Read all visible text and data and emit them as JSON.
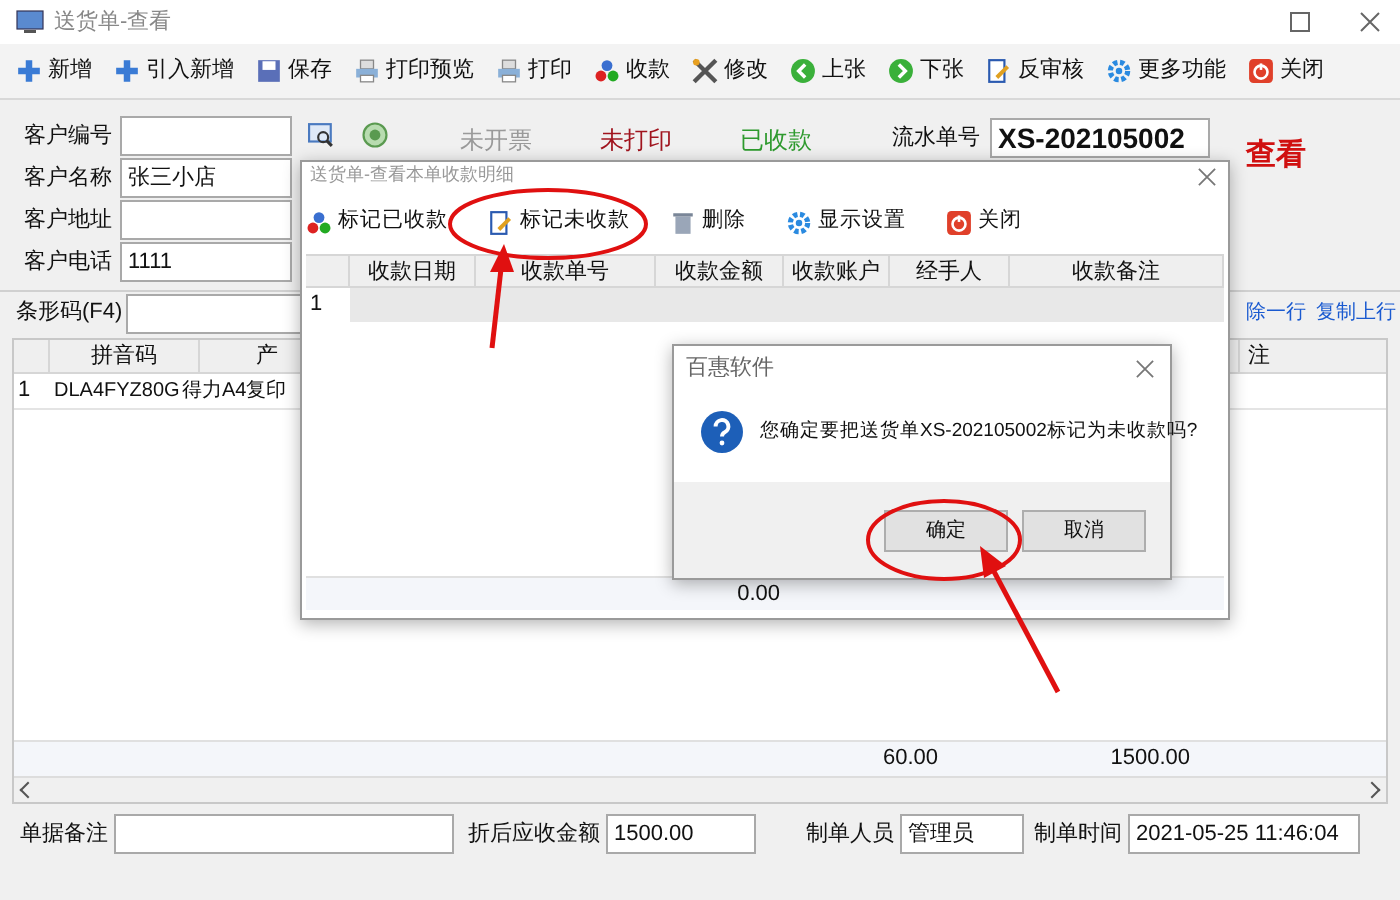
{
  "window": {
    "title": "送货单-查看"
  },
  "toolbar": [
    {
      "label": "新增"
    },
    {
      "label": "引入新增"
    },
    {
      "label": "保存"
    },
    {
      "label": "打印预览"
    },
    {
      "label": "打印"
    },
    {
      "label": "收款"
    },
    {
      "label": "修改"
    },
    {
      "label": "上张"
    },
    {
      "label": "下张"
    },
    {
      "label": "反审核"
    },
    {
      "label": "更多功能"
    },
    {
      "label": "关闭"
    }
  ],
  "customer_fields": [
    {
      "label": "客户编号"
    },
    {
      "label": "客户名称",
      "value": "张三小店"
    },
    {
      "label": "客户地址"
    },
    {
      "label": "客户电话",
      "value": "1111"
    }
  ],
  "status_flags": [
    {
      "text": "未开票",
      "color": "#9a9a9a"
    },
    {
      "text": "未打印",
      "color": "#a0141e"
    },
    {
      "text": "已收款",
      "color": "#2e9a2e"
    }
  ],
  "serial": {
    "label": "流水单号",
    "value": "XS-202105002"
  },
  "mode_label": "查看",
  "barcode": {
    "label": "条形码(F4)"
  },
  "row_actions": [
    "除一行",
    "复制上行"
  ],
  "table": {
    "columns": [
      "拼音码",
      "产",
      "注"
    ],
    "rows": [
      {
        "index": "1",
        "cells": [
          "DLA4FYZ80G",
          "得力A4复印"
        ]
      }
    ],
    "totals": [
      "60.00",
      "1500.00"
    ]
  },
  "footer": {
    "note_label": "单据备注",
    "amount_label": "折后应收金额",
    "amount_value": "1500.00",
    "maker_label": "制单人员",
    "maker_value": "管理员",
    "time_label": "制单时间",
    "time_value": "2021-05-25 11:46:04"
  },
  "payments_dialog": {
    "title": "送货单-查看本单收款明细",
    "toolbar": [
      {
        "label": "标记已收款"
      },
      {
        "label": "标记未收款"
      },
      {
        "label": "删除"
      },
      {
        "label": "显示设置"
      },
      {
        "label": "关闭"
      }
    ],
    "columns": [
      "收款日期",
      "收款单号",
      "收款金额",
      "收款账户",
      "经手人",
      "收款备注"
    ],
    "rows": [
      {
        "index": "1"
      }
    ],
    "total": "0.00"
  },
  "confirm_dialog": {
    "title": "百惠软件",
    "message": "您确定要把送货单XS-202105002标记为未收款吗?",
    "buttons": [
      {
        "label": "确定"
      },
      {
        "label": "取消"
      }
    ]
  }
}
